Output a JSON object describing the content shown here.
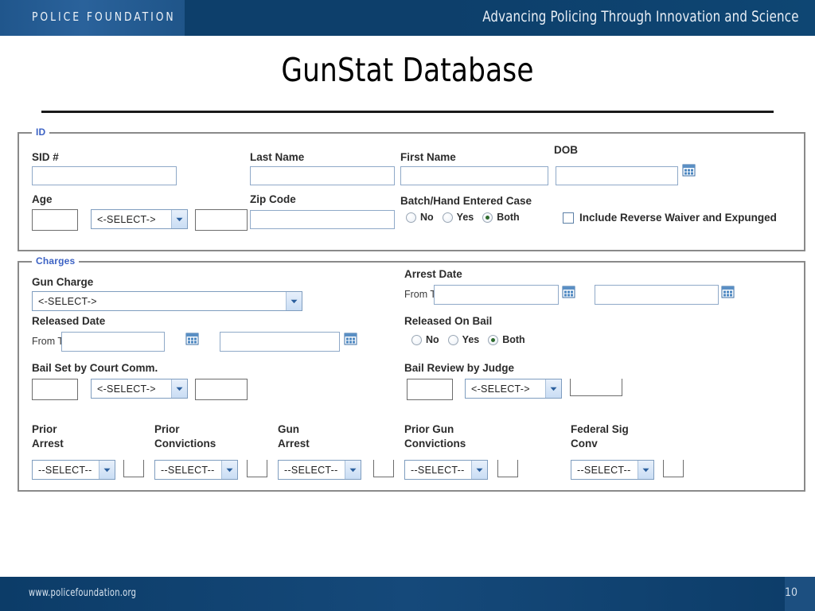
{
  "header": {
    "brand": "POLICE FOUNDATION",
    "tagline": "Advancing Policing Through  Innovation and Science",
    "panel_color": "#2a629b",
    "bar_color": "#0d3f6b"
  },
  "slide": {
    "title": "GunStat Database"
  },
  "form": {
    "id_section": {
      "legend": "ID",
      "sid_label": "SID #",
      "sid_value": "",
      "last_name_label": "Last Name",
      "last_name_value": "",
      "first_name_label": "First Name",
      "first_name_value": "",
      "dob_label": "DOB",
      "dob_value": "",
      "dob_calendar_icon": "calendar-icon",
      "age_label": "Age",
      "age_value": "",
      "age_select_value": "<-SELECT->",
      "age_second_value": "",
      "zip_label": "Zip Code",
      "zip_value": "",
      "batch_label": "Batch/Hand Entered Case",
      "batch_options": [
        "No",
        "Yes",
        "Both"
      ],
      "batch_selected": "Both",
      "include_reverse_label": "Include Reverse Waiver and Expunged",
      "include_reverse_checked": false
    },
    "charges_section": {
      "legend": "Charges",
      "gun_charge_label": "Gun Charge",
      "gun_charge_value": "<-SELECT->",
      "arrest_date_label": "Arrest Date",
      "arrest_date_from_label": "From T",
      "arrest_date_from_value": "",
      "arrest_date_to_value": "",
      "released_date_label": "Released Date",
      "released_date_from_label": "From T",
      "released_date_from_value": "",
      "released_date_to_value": "",
      "released_on_bail_label": "Released On Bail",
      "released_on_bail_options": [
        "No",
        "Yes",
        "Both"
      ],
      "released_on_bail_selected": "Both",
      "bail_court_label": "Bail  Set by Court Comm.",
      "bail_court_amount": "",
      "bail_court_select_value": "<-SELECT->",
      "bail_court_second": "",
      "bail_judge_label": "Bail  Review by Judge",
      "bail_judge_amount": "",
      "bail_judge_select_value": "<-SELECT->",
      "bail_judge_second": "",
      "counters": [
        {
          "label_line1": "Prior",
          "label_line2": "Arrest",
          "select_value": "--SELECT--",
          "box_value": ""
        },
        {
          "label_line1": "Prior",
          "label_line2": "Convictions",
          "select_value": "--SELECT--",
          "box_value": ""
        },
        {
          "label_line1": "Gun",
          "label_line2": "Arrest",
          "select_value": "--SELECT--",
          "box_value": ""
        },
        {
          "label_line1": "Prior Gun",
          "label_line2": "Convictions",
          "select_value": "--SELECT--",
          "box_value": ""
        },
        {
          "label_line1": "Federal Sig",
          "label_line2": "Conv",
          "select_value": "--SELECT--",
          "box_value": ""
        }
      ]
    }
  },
  "footer": {
    "url": "www.policefoundation.org",
    "page_number": "10",
    "bar_color": "#0c3c68"
  }
}
